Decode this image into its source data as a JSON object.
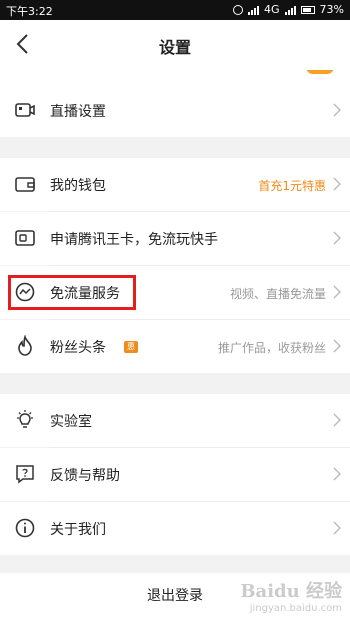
{
  "status_bar": {
    "time": "下午3:22",
    "network": "4G",
    "battery": "73%"
  },
  "header": {
    "title": "设置"
  },
  "items": [
    {
      "label": "直播设置",
      "value": ""
    },
    {
      "label": "我的钱包",
      "value": "首充1元特惠"
    },
    {
      "label": "申请腾讯王卡，免流玩快手",
      "value": ""
    },
    {
      "label": "免流量服务",
      "value": "视频、直播免流量"
    },
    {
      "label": "粉丝头条",
      "badge": "惠",
      "value": "推广作品，收获粉丝"
    },
    {
      "label": "实验室",
      "value": ""
    },
    {
      "label": "反馈与帮助",
      "value": ""
    },
    {
      "label": "关于我们",
      "value": ""
    }
  ],
  "logout": {
    "label": "退出登录"
  },
  "watermark": {
    "logo": "Baidu 经验",
    "url": "jingyan.baidu.com"
  },
  "colors": {
    "accent": "#f08c1c",
    "highlight": "#e41e1e"
  }
}
